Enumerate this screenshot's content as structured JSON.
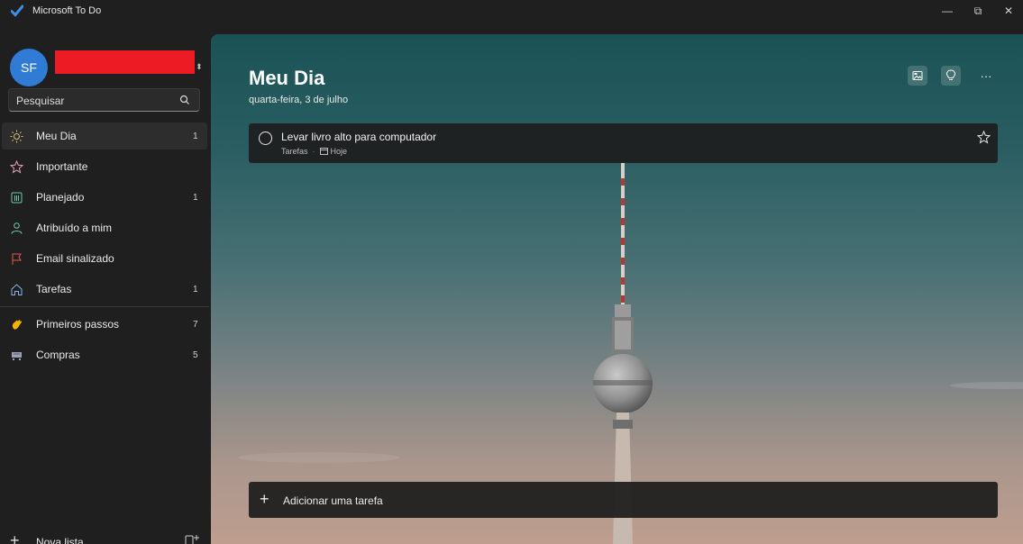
{
  "window": {
    "title": "Microsoft To Do",
    "min_glyph": "—",
    "max_glyph": "⧉",
    "close_glyph": "✕"
  },
  "account": {
    "initials": "SF",
    "name_redacted_color": "#ed1c24"
  },
  "search": {
    "placeholder": "Pesquisar"
  },
  "sidebar": {
    "items": [
      {
        "label": "Meu Dia",
        "count": "1",
        "icon": "sun-icon",
        "active": true
      },
      {
        "label": "Importante",
        "count": "",
        "icon": "star-icon"
      },
      {
        "label": "Planejado",
        "count": "1",
        "icon": "calendar-grid-icon"
      },
      {
        "label": "Atribuído a mim",
        "count": "",
        "icon": "person-icon"
      },
      {
        "label": "Email sinalizado",
        "count": "",
        "icon": "flag-icon"
      },
      {
        "label": "Tarefas",
        "count": "1",
        "icon": "home-icon"
      },
      {
        "label": "Primeiros passos",
        "count": "7",
        "icon": "waving-hand-icon"
      },
      {
        "label": "Compras",
        "count": "5",
        "icon": "shopping-cart-icon"
      }
    ],
    "new_list_label": "Nova lista"
  },
  "main": {
    "title": "Meu Dia",
    "date": "quarta-feira, 3 de julho",
    "more_glyph": "···",
    "task": {
      "title": "Levar livro alto para computador",
      "list": "Tarefas",
      "sep": "·",
      "due": "Hoje"
    },
    "add_task_label": "Adicionar uma tarefa"
  },
  "colors": {
    "accent": "#2f7bd6",
    "sidebar_bg": "#1f1f1f",
    "flag": "#e05a5a",
    "sun": "#d9c27a"
  }
}
